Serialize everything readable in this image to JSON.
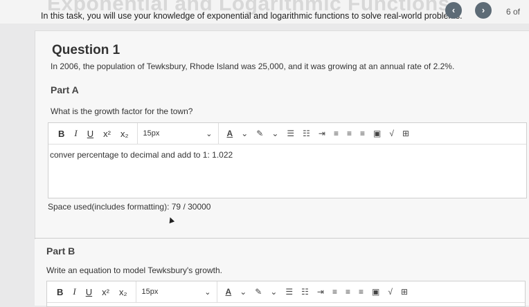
{
  "header": {
    "faded_title": "Exponential and Logarithmic Functions",
    "intro": "In this task, you will use your knowledge of exponential and logarithmic functions to solve real-world problems.",
    "prev_icon": "chevron-left-icon",
    "next_icon": "chevron-right-icon",
    "page_indicator": "6 of"
  },
  "question": {
    "title": "Question 1",
    "text": "In 2006, the population of Tewksbury, Rhode Island was 25,000, and it was growing at an annual rate of 2.2%."
  },
  "partA": {
    "heading": "Part A",
    "prompt": "What is the growth factor for the town?",
    "editor": {
      "bold": "B",
      "italic": "I",
      "underline": "U",
      "superscript": "x²",
      "subscript": "x₂",
      "font_size": "15px",
      "content": "conver percentage to decimal and add to 1: 1.022"
    },
    "space_used": "Space used(includes formatting): 79 / 30000"
  },
  "partB": {
    "heading": "Part B",
    "prompt": "Write an equation to model Tewksbury's growth.",
    "editor": {
      "bold": "B",
      "italic": "I",
      "underline": "U",
      "superscript": "x²",
      "subscript": "x₂",
      "font_size": "15px"
    }
  }
}
